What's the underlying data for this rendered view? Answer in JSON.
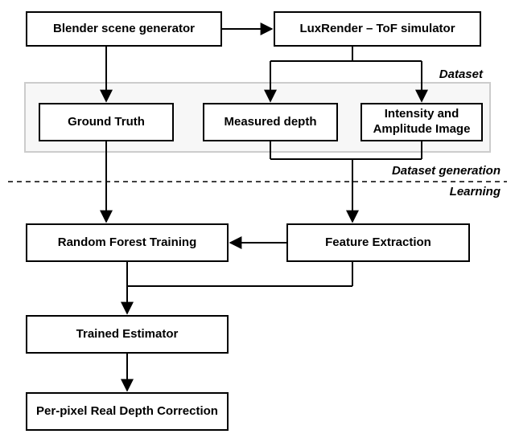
{
  "boxes": {
    "blender": "Blender scene generator",
    "luxrender": "LuxRender – ToF simulator",
    "ground_truth": "Ground Truth",
    "measured_depth": "Measured depth",
    "intensity_amp": "Intensity and Amplitude Image",
    "rf_training": "Random Forest Training",
    "feature_ext": "Feature Extraction",
    "trained_est": "Trained Estimator",
    "correction": "Per-pixel Real Depth Correction"
  },
  "labels": {
    "dataset": "Dataset",
    "datagen": "Dataset generation",
    "learning": "Learning"
  }
}
